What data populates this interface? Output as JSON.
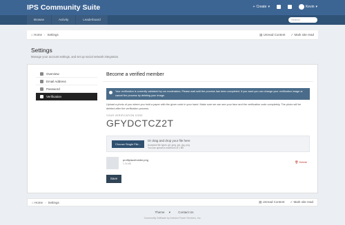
{
  "header": {
    "site_title": "IPS Community Suite",
    "create_label": "Create",
    "user_name": "Kevin"
  },
  "nav": {
    "tabs": [
      "Browse",
      "Activity",
      "Leaderboard"
    ],
    "search_placeholder": "Search"
  },
  "breadcrumb": {
    "home": "Home",
    "current": "Settings",
    "unread": "Unread Content",
    "mark_read": "Mark site read"
  },
  "page": {
    "title": "Settings",
    "subtitle": "Manage your account settings, and set up social network integration."
  },
  "sidebar": {
    "items": [
      {
        "label": "Overview",
        "icon": "home-icon"
      },
      {
        "label": "Email Address",
        "icon": "envelope-icon"
      },
      {
        "label": "Password",
        "icon": "key-icon"
      },
      {
        "label": "Verification",
        "icon": "check-icon"
      }
    ],
    "active": "Verification"
  },
  "verification": {
    "title": "Become a verified member",
    "notice": "Your verification is currently validated by our moderators. Please wait until the process has been completed. If you want you can change your verification image or cancel the process by deleting your image.",
    "description": "Upload a photo of you where you hold a paper with the given code in your hand. Make sure we can see your face and the verification code completely. The photo will be deleted after the verification process.",
    "code_label": "YOUR VERIFICATION CODE",
    "code": "GFYDCTCZ2T",
    "choose_label": "Choose Single File...",
    "drop_label": "Or drag and drop your file here",
    "accepted": "Accepted file types: gif, jpeg, jpe, jpg, png",
    "max_size": "You can upload a maximum of 1 file",
    "file_name": "profilplaceholder.png",
    "file_size": "1.34 kB",
    "delete_label": "Delete",
    "save_label": "Save"
  },
  "footer": {
    "theme": "Theme",
    "contact": "Contact Us",
    "copyright": "Community Software by Invision Power Services, Inc."
  },
  "colors": {
    "topbar": "#3d6594",
    "navbar": "#2f5277",
    "active_side": "#222222",
    "notice": "#4a6c8a"
  }
}
